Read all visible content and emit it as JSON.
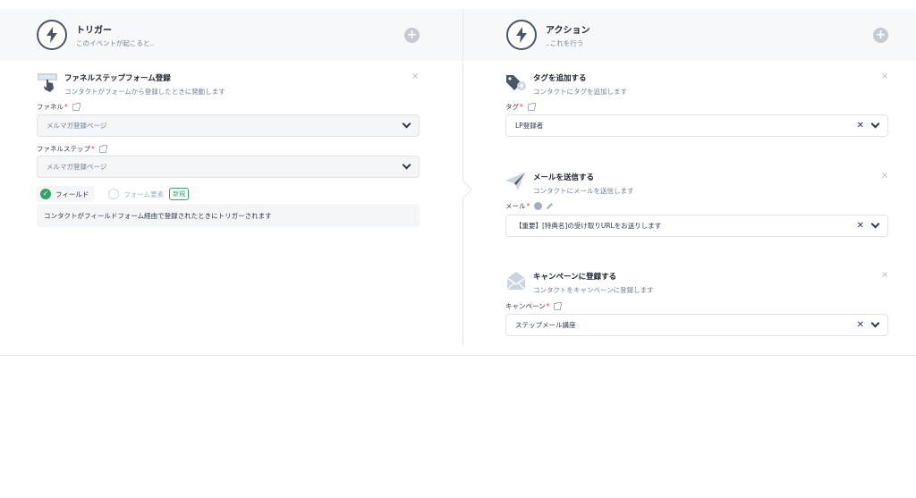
{
  "trigger": {
    "title": "トリガー",
    "subtitle": "このイベントが起こると..",
    "block": {
      "title": "ファネルステップフォーム登録",
      "subtitle": "コンタクトがフォームから登録したときに発動します",
      "funnel_label": "ファネル",
      "funnel_value": "メルマガ登録ページ",
      "step_label": "ファネルステップ",
      "step_value": "メルマガ登録ページ",
      "option_field": "フィールド",
      "option_form": "フォーム要素",
      "new_badge": "新規",
      "note": "コンタクトがフィールドフォーム経由で登録されたときにトリガーされます"
    }
  },
  "action": {
    "title": "アクション",
    "subtitle": "..これを行う",
    "blocks": [
      {
        "title": "タグを追加する",
        "subtitle": "コンタクトにタグを追加します",
        "label": "タグ",
        "value": "LP登録者"
      },
      {
        "title": "メールを送信する",
        "subtitle": "コンタクトにメールを送信します",
        "label": "メール",
        "value": "【重要】[特典名]の受け取りURLをお送りします"
      },
      {
        "title": "キャンペーンに登録する",
        "subtitle": "コンタクトをキャンペーンに登録します",
        "label": "キャンペーン",
        "value": "ステップメール講座"
      }
    ]
  },
  "symbols": {
    "required": "*",
    "close": "×",
    "plus": "+",
    "clear": "✕",
    "check": "✓"
  },
  "colors": {
    "accent_green": "#38a169",
    "required_red": "#e53e3e",
    "band_bg": "#f7f8fa"
  }
}
